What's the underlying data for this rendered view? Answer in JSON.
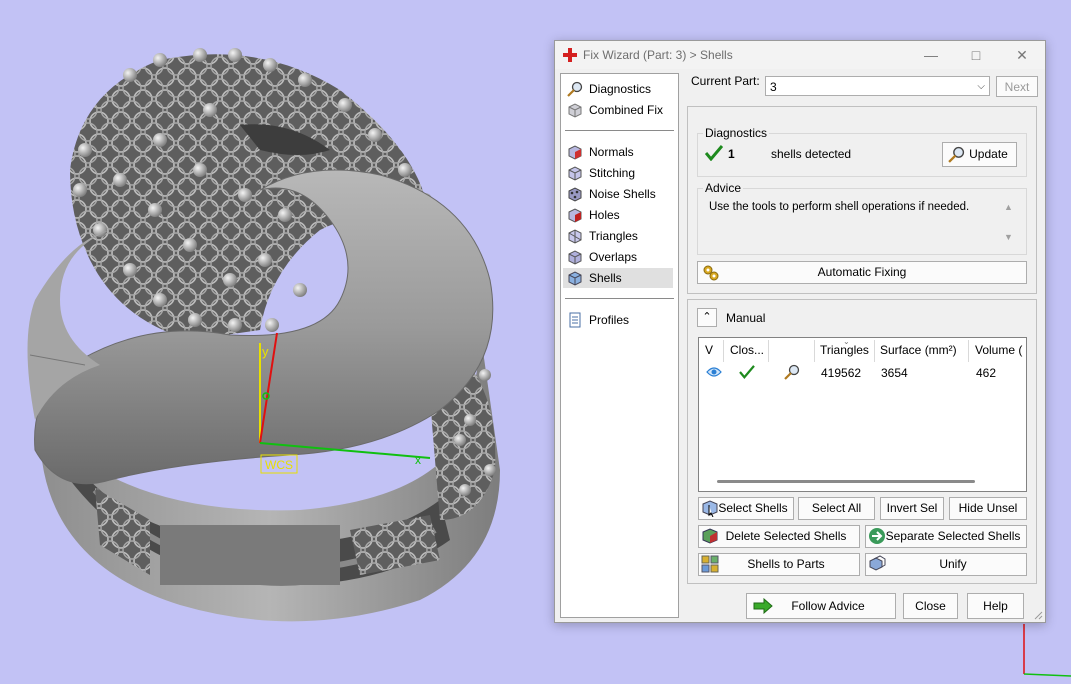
{
  "viewport": {
    "wcs_label": "WCS",
    "axis_y_label": "y",
    "axis_x_label": "x"
  },
  "dialog": {
    "title": "Fix Wizard (Part: 3) > Shells",
    "nav": {
      "top": [
        "Diagnostics",
        "Combined Fix"
      ],
      "tools": [
        "Normals",
        "Stitching",
        "Noise Shells",
        "Holes",
        "Triangles",
        "Overlaps",
        "Shells"
      ],
      "bottom": [
        "Profiles"
      ],
      "active": "Shells"
    },
    "current_part_label": "Current Part:",
    "current_part_value": "3",
    "next_label": "Next",
    "diagnostics": {
      "title": "Diagnostics",
      "count": "1",
      "text": "shells detected",
      "update_label": "Update"
    },
    "advice": {
      "title": "Advice",
      "text": "Use the tools to perform shell operations if needed."
    },
    "automatic_fixing_label": "Automatic Fixing",
    "manual_label": "Manual",
    "table": {
      "columns": [
        "V",
        "Clos...",
        "",
        "Triangles",
        "Surface (mm²)",
        "Volume ("
      ],
      "rows": [
        {
          "triangles": "419562",
          "surface": "3654",
          "volume": "462"
        }
      ]
    },
    "buttons": {
      "select_shells": "Select Shells",
      "select_all": "Select All",
      "invert_sel": "Invert Sel",
      "hide_unsel": "Hide Unsel",
      "delete_selected": "Delete Selected Shells",
      "separate_selected": "Separate Selected Shells",
      "shells_to_parts": "Shells to Parts",
      "unify": "Unify",
      "follow_advice": "Follow Advice",
      "close": "Close",
      "help": "Help"
    },
    "colors": {
      "background": "#c2c2f5",
      "check_green": "#1e8a1e",
      "eye_blue": "#2a7fd4"
    }
  }
}
